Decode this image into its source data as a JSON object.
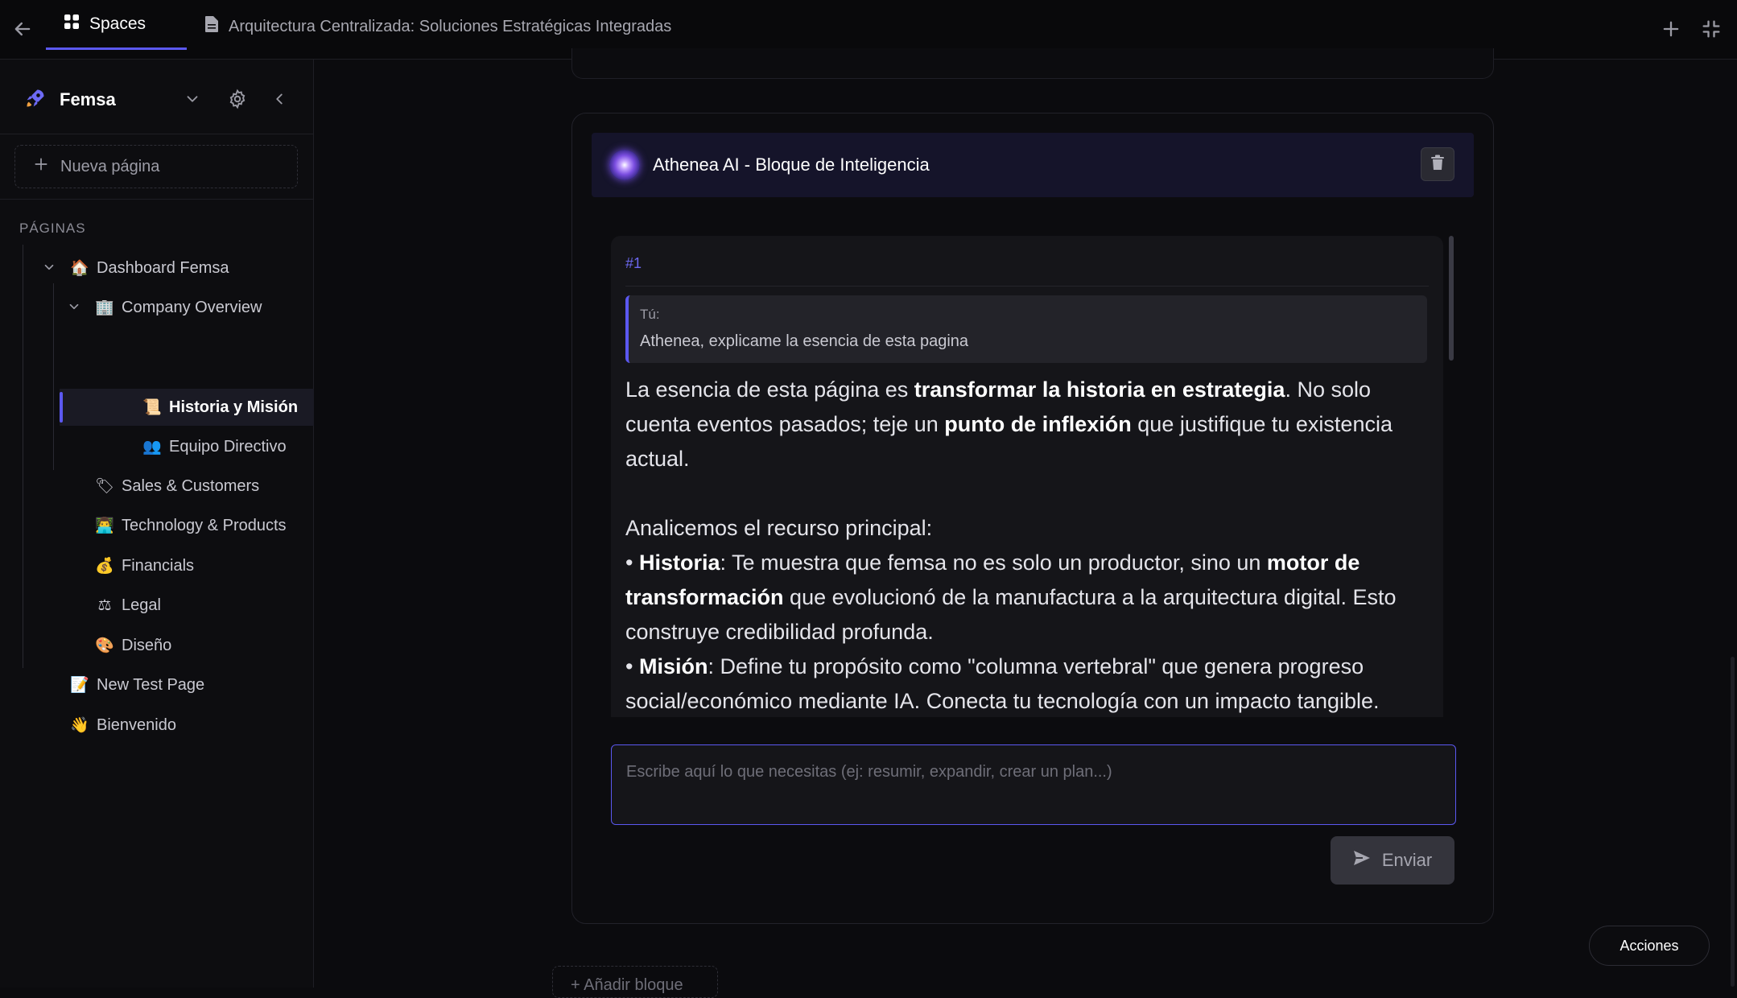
{
  "topbar": {
    "spaces_label": "Spaces",
    "doc_title": "Arquitectura Centralizada: Soluciones Estratégicas Integradas"
  },
  "sidebar": {
    "workspace_name": "Femsa",
    "new_page_label": "Nueva página",
    "section_label": "PÁGINAS",
    "items": [
      {
        "label": "Dashboard Femsa",
        "emoji": "🏠"
      },
      {
        "label": "Company Overview",
        "emoji": "🏢"
      },
      {
        "label": "Historia y Misión",
        "emoji": "📜"
      },
      {
        "label": "Equipo Directivo",
        "emoji": "👥"
      },
      {
        "label": "Sales & Customers",
        "emoji": "🏷"
      },
      {
        "label": "Technology & Products",
        "emoji": "👨‍💻"
      },
      {
        "label": "Financials",
        "emoji": "💰"
      },
      {
        "label": "Legal",
        "emoji": "⚖"
      },
      {
        "label": "Diseño",
        "emoji": "🎨"
      },
      {
        "label": "New Test Page",
        "emoji": "📝"
      },
      {
        "label": "Bienvenido",
        "emoji": "👋"
      }
    ]
  },
  "ai_block": {
    "title": "Athenea AI - Bloque de Inteligencia",
    "turn_number": "#1",
    "user_label": "Tú:",
    "user_message": "Athenea, explicame la esencia de esta pagina",
    "reply": {
      "p1_a": "La esencia de esta página es ",
      "p1_b": "transformar la historia en estrategia",
      "p1_c": ". No solo cuenta eventos pasados; teje un ",
      "p1_d": "punto de inflexión",
      "p1_e": " que justifique tu existencia actual.",
      "p2": "Analicemos el recurso principal:",
      "b1_bullet": "• ",
      "b1_a": "Historia",
      "b1_b": ": Te muestra que femsa no es solo un productor, sino un ",
      "b1_c": "motor de transformación",
      "b1_d": " que evolucionó de la manufactura a la arquitectura digital. Esto construye credibilidad profunda.",
      "b2_bullet": "• ",
      "b2_a": "Misión",
      "b2_b": ": Define tu propósito como \"columna vertebral\" que genera progreso social/económico mediante IA. Conecta tu tecnología con un impacto tangible."
    },
    "input_placeholder": "Escribe aquí lo que necesitas (ej: resumir, expandir, crear un plan...)",
    "send_label": "Enviar"
  },
  "add_block_label": "+ Añadir bloque",
  "actions_label": "Acciones",
  "colors": {
    "accent": "#5b58f0",
    "background": "#0b0b0e",
    "sidebar": "#0d0d10"
  }
}
